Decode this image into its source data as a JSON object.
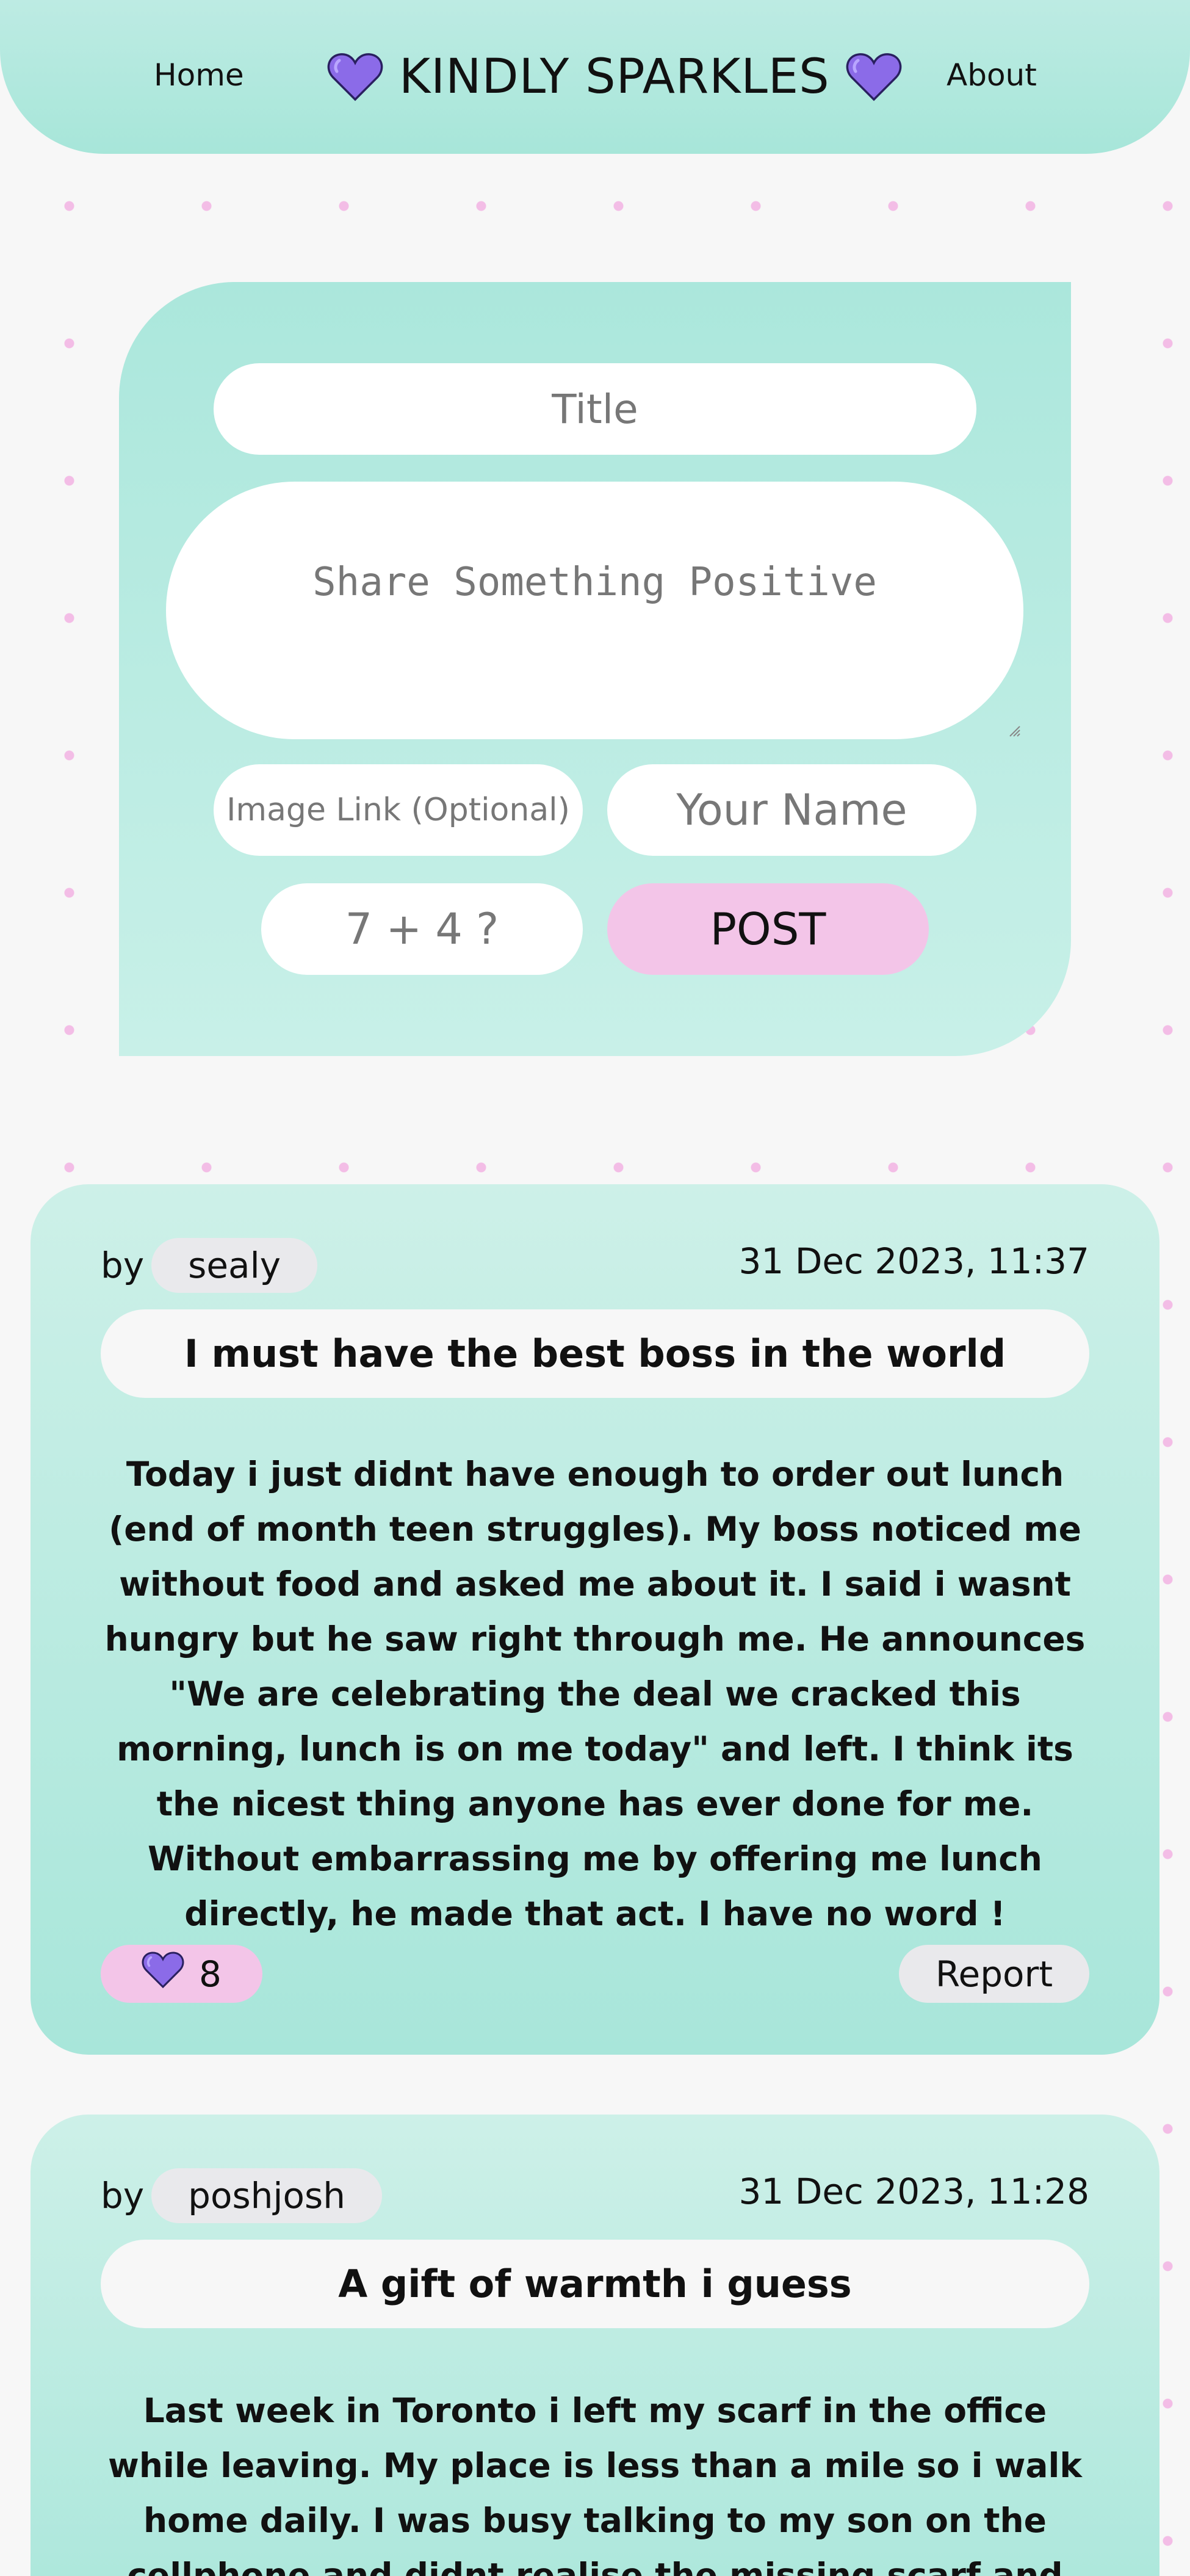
{
  "header": {
    "nav_home": "Home",
    "brand_title": "KINDLY SPARKLES",
    "nav_about": "About",
    "heart_icon": "purple-heart",
    "accent_color": "#8b6be8"
  },
  "form": {
    "title_placeholder": "Title",
    "message_placeholder": "Share Something Positive",
    "image_placeholder": "Image Link (Optional)",
    "name_placeholder": "Your Name",
    "captcha_placeholder": "7 + 4 ?",
    "post_label": "POST"
  },
  "posts": [
    {
      "by_label": "by",
      "author": "sealy",
      "timestamp": "31 Dec 2023, 11:37",
      "title": "I must have the best boss in the world",
      "body": "Today i just didnt have enough to order out lunch (end of month teen struggles). My boss noticed me without food and asked me about it. I said i wasnt hungry but he saw right through me. He announces \"We are celebrating the deal we cracked this morning, lunch is on me today\" and left. I think its the nicest thing anyone has ever done for me. Without embarrassing me by offering me lunch directly, he made that act. I have no word !",
      "likes": "8",
      "report_label": "Report"
    },
    {
      "by_label": "by",
      "author": "poshjosh",
      "timestamp": "31 Dec 2023, 11:28",
      "title": "A gift of warmth i guess",
      "body": "Last week in Toronto i left my scarf in the office while leaving. My place is less than a mile so i walk home daily. I was busy talking to my son on the cellphone and didnt realise the missing scarf and the harsh toronto december"
    }
  ]
}
